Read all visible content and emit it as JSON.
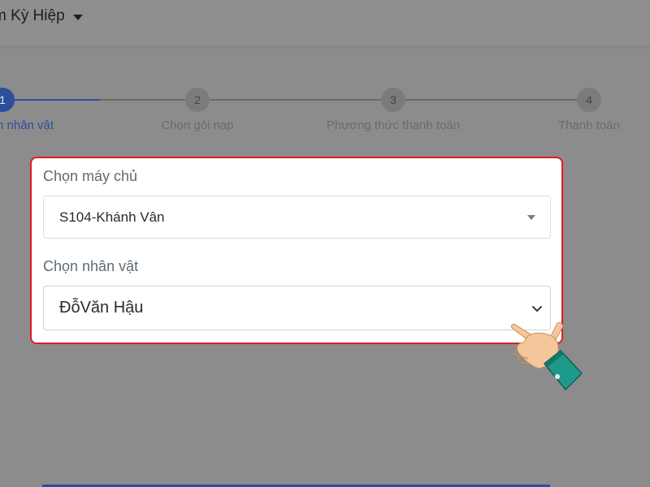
{
  "header": {
    "game_name": "m Kỳ Hiệp",
    "dropdown_icon": "caret-down-icon"
  },
  "stepper": {
    "steps": [
      {
        "number": "1",
        "label": "n nhân vật",
        "active": true
      },
      {
        "number": "2",
        "label": "Chọn gói nạp",
        "active": false
      },
      {
        "number": "3",
        "label": "Phương thức thanh toán",
        "active": false
      },
      {
        "number": "4",
        "label": "Thanh toán",
        "active": false
      }
    ]
  },
  "form": {
    "server": {
      "label": "Chọn máy chủ",
      "value": "S104-Khánh Vân",
      "icon": "triangle-down-icon"
    },
    "character": {
      "label": "Chọn nhân vật",
      "value": "ĐỗVăn Hậu",
      "icon": "chevron-down-icon"
    }
  },
  "colors": {
    "accent": "#2d4e9b",
    "highlight_border": "#e11b22",
    "overlay": "#8c8c8c"
  },
  "decor": {
    "pointer": "hand-pointer-icon"
  }
}
